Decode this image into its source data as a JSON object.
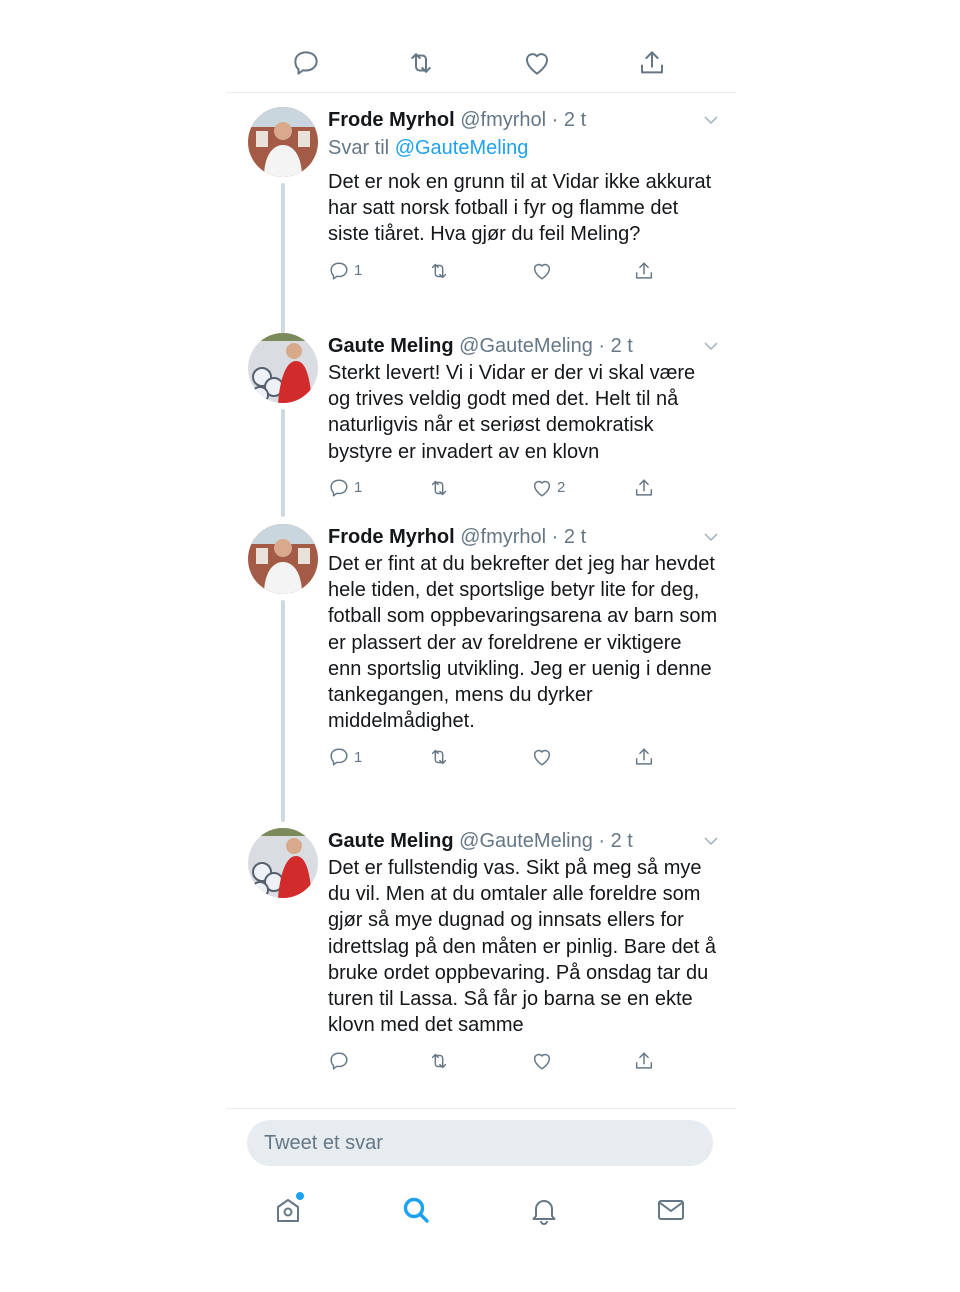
{
  "colors": {
    "accent": "#1da1f2",
    "text": "#14171a",
    "muted": "#657786",
    "border": "#e6ecf0"
  },
  "top_actions": [
    "reply-icon",
    "retweet-icon",
    "like-icon",
    "share-icon"
  ],
  "tweets": [
    {
      "name": "Frode Myrhol",
      "handle": "@fmyrhol",
      "time": "· 2 t",
      "reply_prefix": "Svar til",
      "reply_mention": "@GauteMeling",
      "text": "Det er nok en grunn til at Vidar ikke akkurat har satt norsk fotball i fyr og flamme det siste tiåret. Hva gjør du feil Meling?",
      "reply_count": "1",
      "retweet_count": "",
      "like_count": ""
    },
    {
      "name": "Gaute Meling",
      "handle": "@GauteMeling",
      "time": "· 2 t",
      "text": "Sterkt levert! Vi i Vidar er der vi skal være og trives veldig godt med det. Helt til nå naturligvis når et seriøst demokratisk bystyre er invadert av en klovn",
      "reply_count": "1",
      "retweet_count": "",
      "like_count": "2"
    },
    {
      "name": "Frode Myrhol",
      "handle": "@fmyrhol",
      "time": "· 2 t",
      "text": "Det er fint at du bekrefter det jeg har hevdet hele tiden, det sportslige betyr lite for deg, fotball som oppbevaringsarena av barn som er plassert der av foreldrene er viktigere enn sportslig utvikling. Jeg er uenig i denne tankegangen, mens du dyrker middelmådighet.",
      "reply_count": "1",
      "retweet_count": "",
      "like_count": ""
    },
    {
      "name": "Gaute Meling",
      "handle": "@GauteMeling",
      "time": "· 2 t",
      "text": "Det er fullstendig vas. Sikt på meg så mye du vil. Men at du omtaler alle foreldre som gjør så mye dugnad og innsats ellers for idrettslag på den måten er pinlig. Bare det å bruke ordet oppbevaring. På onsdag tar du turen til Lassa. Så får jo barna se en ekte klovn med det samme",
      "reply_count": "",
      "retweet_count": "",
      "like_count": ""
    }
  ],
  "composer": {
    "placeholder": "Tweet et svar"
  },
  "tabbar": [
    "home-icon",
    "search-icon",
    "notifications-icon",
    "messages-icon"
  ]
}
